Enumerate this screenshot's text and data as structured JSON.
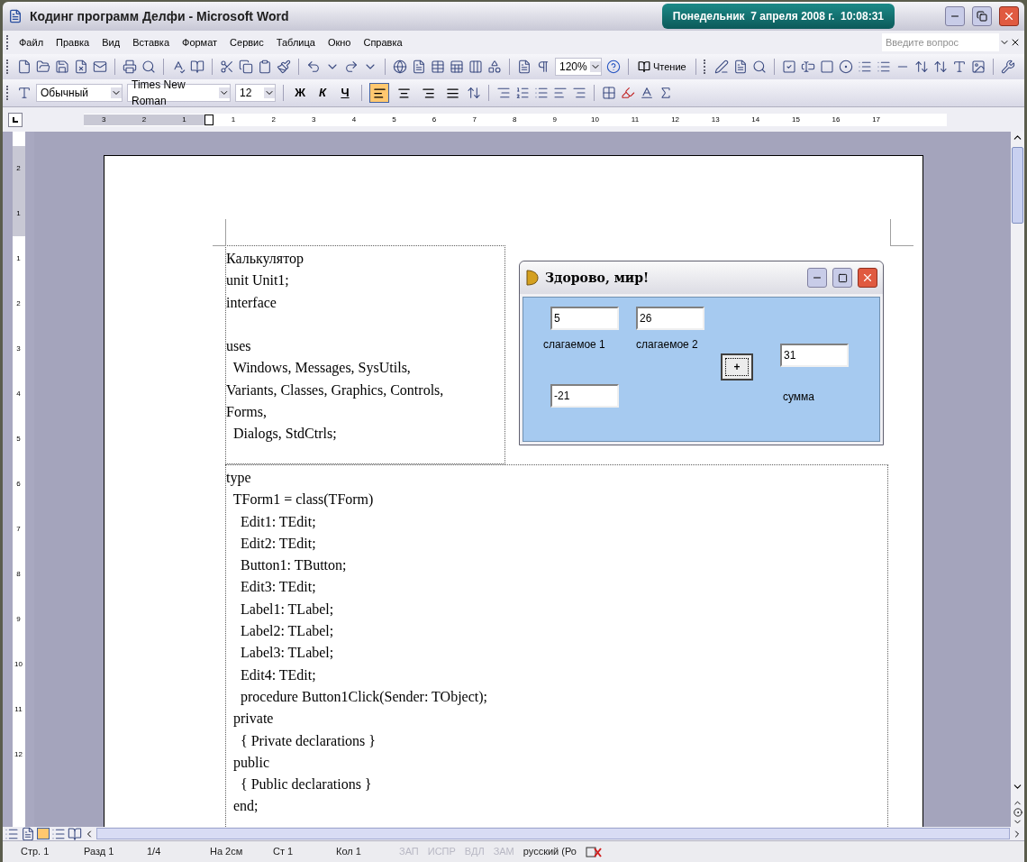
{
  "window": {
    "title": "Кодинг программ Делфи - Microsoft Word",
    "clock": "Понедельник  7 апреля 2008 г.  10:08:31"
  },
  "menu": [
    "Файл",
    "Правка",
    "Вид",
    "Вставка",
    "Формат",
    "Сервис",
    "Таблица",
    "Окно",
    "Справка"
  ],
  "help_search": {
    "placeholder": "Введите вопрос"
  },
  "standard_toolbar": {
    "zoom": "120%",
    "reading_button": "Чтение"
  },
  "formatting_toolbar": {
    "style": "Обычный",
    "font": "Times New Roman",
    "size": "12",
    "bold": "Ж",
    "italic": "К",
    "underline": "Ч",
    "align_buttons": [
      {
        "selected": true
      },
      {
        "selected": false
      },
      {
        "selected": false
      },
      {
        "selected": false
      }
    ]
  },
  "ruler": {
    "labels": [
      "3",
      "2",
      "1",
      "1",
      "2",
      "3",
      "4",
      "5",
      "6",
      "7",
      "8",
      "9",
      "10",
      "11",
      "12",
      "13",
      "14",
      "15",
      "16",
      "17"
    ]
  },
  "vertical_ruler": {
    "labels": [
      "2",
      "1",
      "1",
      "2",
      "3",
      "4",
      "5",
      "6",
      "7",
      "8",
      "9",
      "10",
      "11",
      "12"
    ]
  },
  "document": {
    "top_paragraphs": [
      [
        "Калькулятор",
        "unit Unit1;",
        "interface"
      ],
      [
        "uses",
        "  Windows, Messages, SysUtils,",
        "Variants, Classes, Graphics, Controls,",
        "Forms,",
        "  Dialogs, StdCtrls;"
      ]
    ],
    "bottom_lines": [
      "type",
      "  TForm1 = class(TForm)",
      "    Edit1: TEdit;",
      "    Edit2: TEdit;",
      "    Button1: TButton;",
      "    Edit3: TEdit;",
      "    Label1: TLabel;",
      "    Label2: TLabel;",
      "    Label3: TLabel;",
      "    Edit4: TEdit;",
      "    procedure Button1Click(Sender: TObject);",
      "  private",
      "    { Private declarations }",
      "  public",
      "    { Public declarations }",
      "  end;"
    ]
  },
  "form_window": {
    "title": "Здорово, мир!",
    "edit1": "5",
    "edit2": "26",
    "label1": "слагаемое 1",
    "label2": "слагаемое 2",
    "button": "+",
    "edit3": "31",
    "label3": "сумма",
    "edit4": "-21"
  },
  "status_bar": [
    {
      "text": "Стр. 1",
      "disabled": false
    },
    {
      "text": "Разд 1",
      "disabled": false
    },
    {
      "text": "1/4",
      "disabled": false
    },
    {
      "text": "На 2см",
      "disabled": false
    },
    {
      "text": "Ст 1",
      "disabled": false
    },
    {
      "text": "Кол 1",
      "disabled": false
    },
    {
      "text": "ЗАП",
      "disabled": true
    },
    {
      "text": "ИСПР",
      "disabled": true
    },
    {
      "text": "ВДЛ",
      "disabled": true
    },
    {
      "text": "ЗАМ",
      "disabled": true
    },
    {
      "text": "русский (Ро",
      "disabled": false
    }
  ]
}
